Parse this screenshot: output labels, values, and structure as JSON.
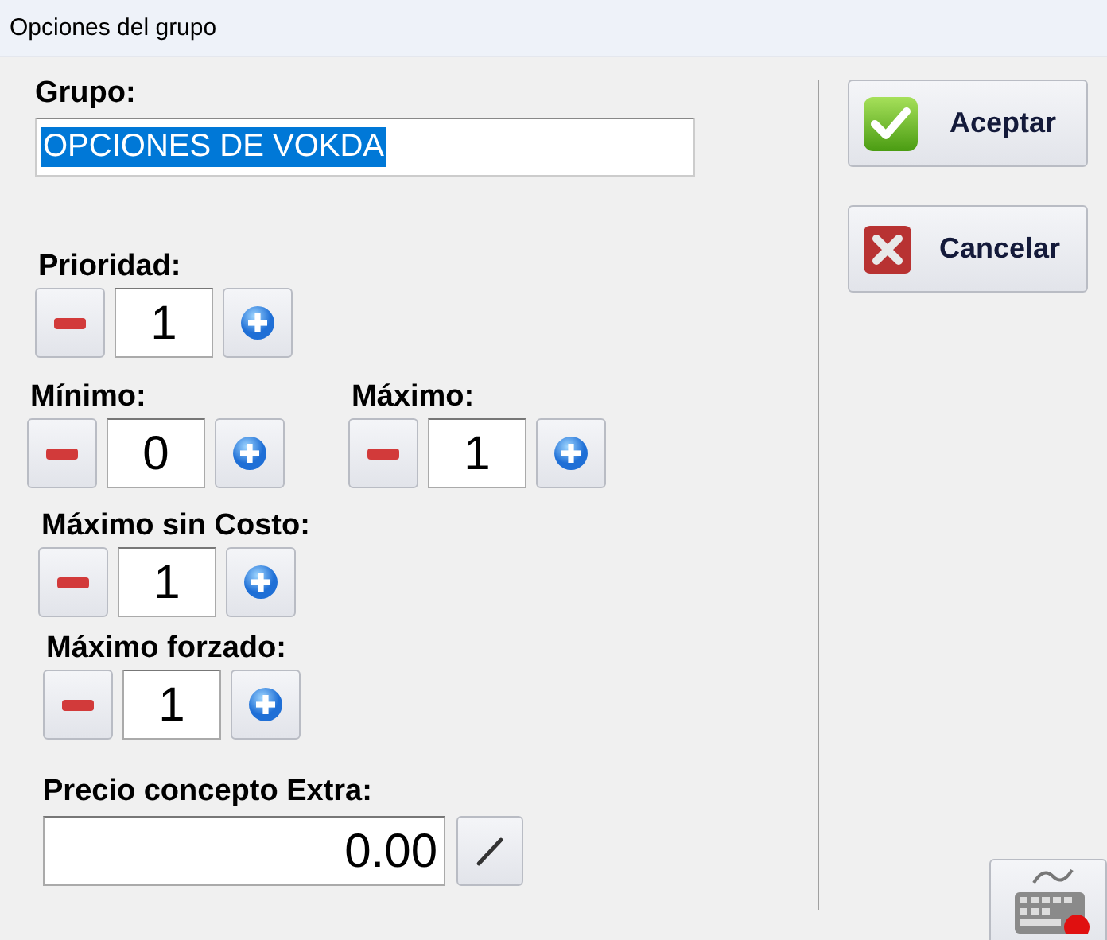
{
  "window": {
    "title": "Opciones del grupo"
  },
  "group": {
    "label": "Grupo:",
    "value": "OPCIONES DE VOKDA",
    "selected": true
  },
  "spinners": [
    {
      "label": "Prioridad:",
      "value": "1"
    },
    {
      "label": "Mínimo:",
      "value": "0"
    },
    {
      "label": "Máximo:",
      "value": "1"
    },
    {
      "label": "Máximo sin Costo:",
      "value": "1"
    },
    {
      "label": "Máximo forzado:",
      "value": "1"
    }
  ],
  "extra_price": {
    "label": "Precio concepto Extra:",
    "value": "0.00"
  },
  "buttons": [
    {
      "kind": "accept",
      "label": "Aceptar"
    },
    {
      "kind": "cancel",
      "label": "Cancelar"
    }
  ]
}
